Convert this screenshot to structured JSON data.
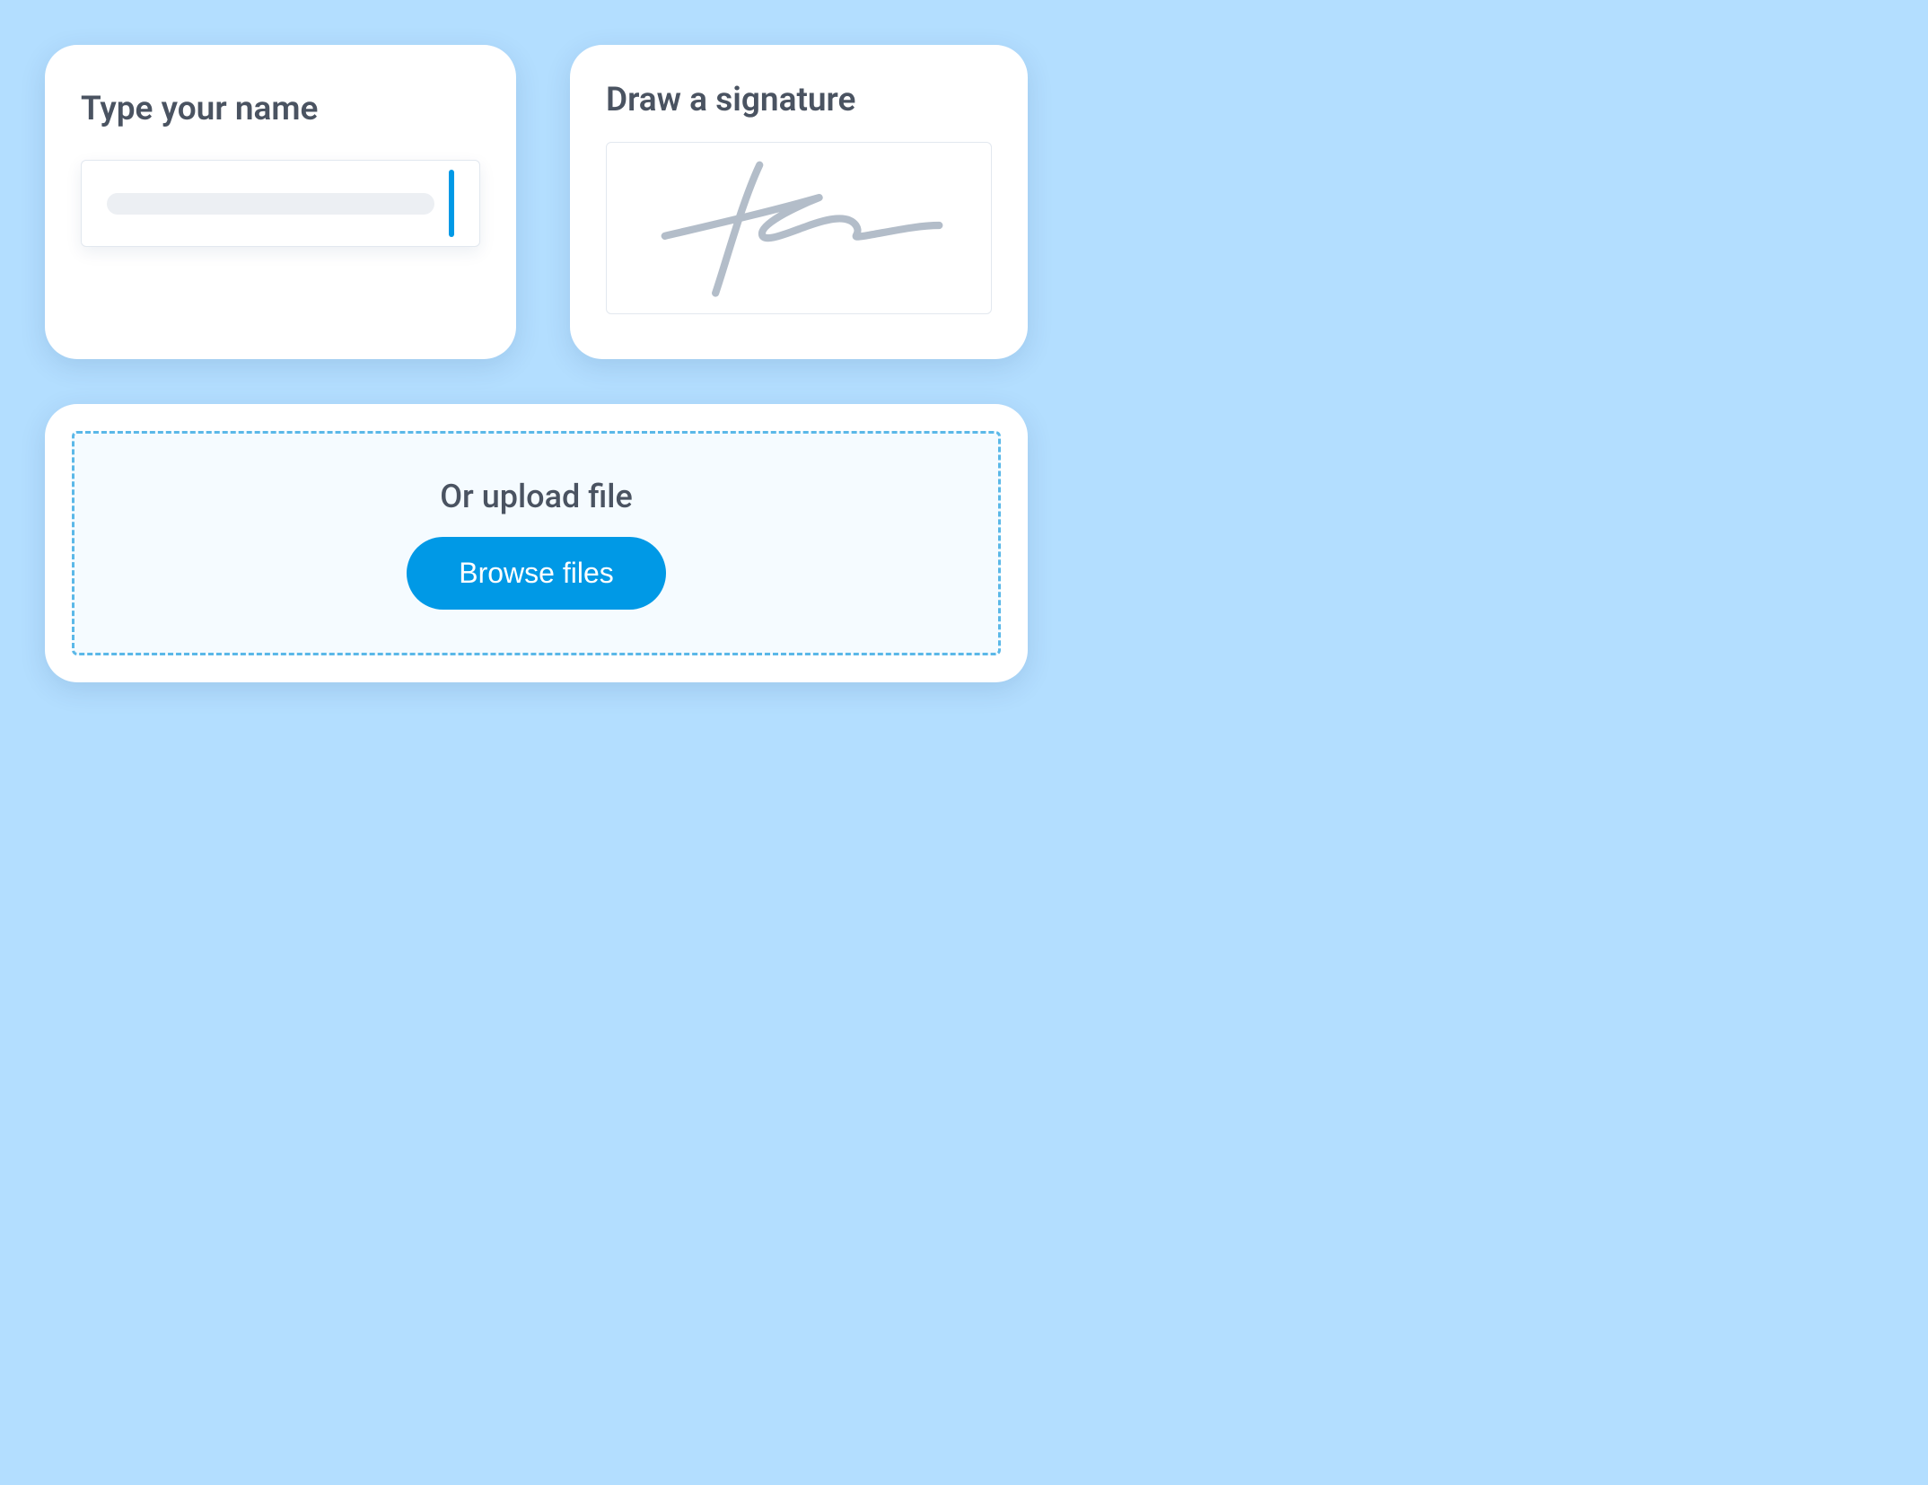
{
  "typeName": {
    "title": "Type your name",
    "value": ""
  },
  "drawSignature": {
    "title": "Draw a signature"
  },
  "upload": {
    "label": "Or upload file",
    "buttonLabel": "Browse files"
  },
  "colors": {
    "accent": "#0099e6",
    "background": "#b3deff",
    "text": "#4a5361",
    "dashBorder": "#5bb8e8",
    "dropzoneBg": "#f5fbff"
  }
}
